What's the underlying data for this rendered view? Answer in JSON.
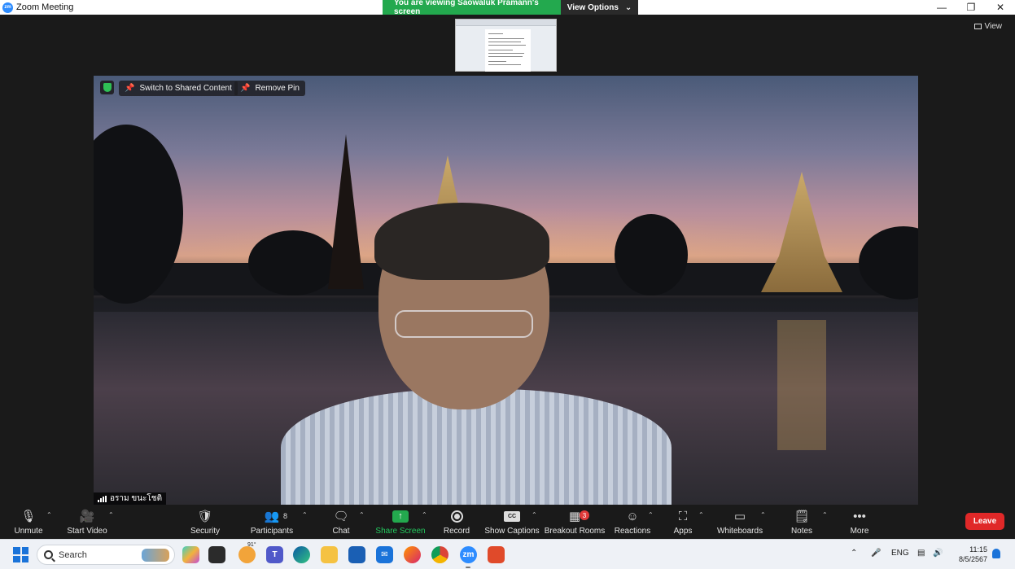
{
  "window": {
    "title": "Zoom Meeting"
  },
  "banner": {
    "message": "You are viewing Saowaluk Pramann's screen",
    "options_label": "View Options"
  },
  "view_label": "View",
  "video": {
    "switch_label": "Switch to Shared Content",
    "remove_pin_label": "Remove Pin",
    "participant_name": "อราม ขนะโชติ"
  },
  "toolbar": {
    "unmute": "Unmute",
    "start_video": "Start Video",
    "security": "Security",
    "participants": "Participants",
    "participants_count": "8",
    "chat": "Chat",
    "share_screen": "Share Screen",
    "record": "Record",
    "show_captions": "Show Captions",
    "captions_icon_text": "CC",
    "breakout_rooms": "Breakout Rooms",
    "breakout_badge": "3",
    "reactions": "Reactions",
    "apps": "Apps",
    "whiteboards": "Whiteboards",
    "notes": "Notes",
    "more": "More",
    "leave": "Leave"
  },
  "taskbar": {
    "search_placeholder": "Search",
    "weather_temp": "91°",
    "language": "ENG",
    "time": "11:15",
    "date": "8/5/2567"
  },
  "colors": {
    "accent_green": "#23a94e",
    "leave_red": "#e02828",
    "zoom_blue": "#2d8cff"
  }
}
